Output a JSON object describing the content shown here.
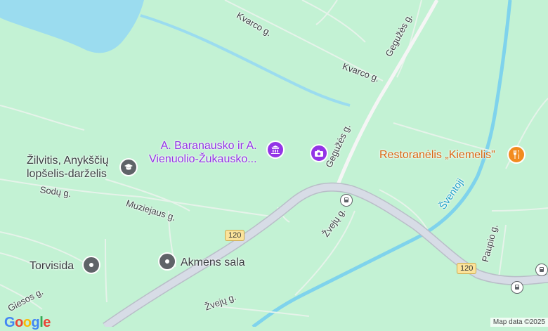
{
  "map": {
    "colors": {
      "land": "#c3f2d4",
      "water": "#9bdcef",
      "road": "#d7dce6",
      "street": "#ffffff"
    },
    "streets": {
      "kvarco_1": "Kvarco g.",
      "kvarco_2": "Kvarco g.",
      "geguzes_1": "Gegužės g.",
      "geguzes_2": "Gegužės g.",
      "sodu": "Sodų g.",
      "muziejaus": "Muziejaus g.",
      "zveju_1": "Žvejų g.",
      "zveju_2": "Žvejų g.",
      "paupio": "Paupio g.",
      "giesos": "Giesos g."
    },
    "river": "Šventoji",
    "route_shields": [
      "120",
      "120"
    ],
    "pois": {
      "museum": {
        "line1": "A. Baranausko ir A.",
        "line2": "Vienuolio-Žukausko...",
        "icon": "museum-icon"
      },
      "kindergarten": {
        "line1": "Žilvitis, Anykščių",
        "line2": "lopšelis-darželis",
        "icon": "school-icon"
      },
      "restaurant": {
        "name": "Restoranėlis „Kiemelis\"",
        "icon": "restaurant-icon"
      },
      "torvisida": {
        "name": "Torvisida",
        "icon": "place-pin-icon"
      },
      "akmens": {
        "name": "Akmens sala",
        "icon": "place-pin-icon"
      },
      "photo": {
        "icon": "camera-icon"
      }
    },
    "logo": "Google",
    "attribution": "Map data ©2025"
  }
}
